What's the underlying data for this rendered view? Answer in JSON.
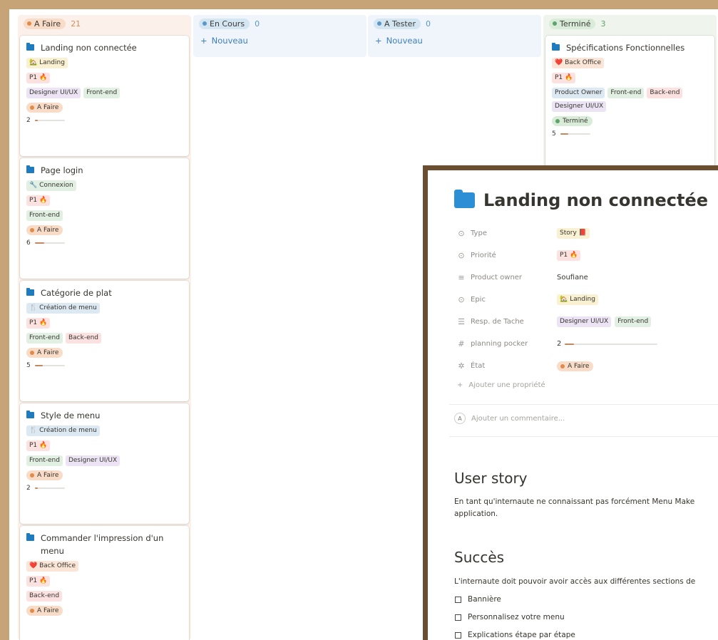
{
  "board": {
    "columns": [
      {
        "status": "A Faire",
        "count": "21",
        "color": "#e08b4a",
        "pill_bg": "#f8dcc8"
      },
      {
        "status": "En Cours",
        "count": "0",
        "color": "#5b97c9",
        "pill_bg": "#d5e6f3",
        "new_label": "Nouveau"
      },
      {
        "status": "A Tester",
        "count": "0",
        "color": "#5b97c9",
        "pill_bg": "#d5e6f3",
        "new_label": "Nouveau"
      },
      {
        "status": "Terminé",
        "count": "3",
        "color": "#5ea36a",
        "pill_bg": "#d8ecd9"
      }
    ],
    "cards": [
      {
        "title": "Landing non connectée",
        "epic": "🏡 Landing",
        "priority": "P1 🔥",
        "roles": [
          "Designer UI/UX",
          "Front-end"
        ],
        "state": "A Faire",
        "points": "2",
        "progress": 0.1
      },
      {
        "title": "Page login",
        "epic": "🔧 Connexion",
        "priority": "P1 🔥",
        "roles": [
          "Front-end"
        ],
        "state": "A Faire",
        "points": "6",
        "progress": 0.3
      },
      {
        "title": "Catégorie de plat",
        "epic": "🍴 Création de menu",
        "priority": "P1 🔥",
        "roles": [
          "Front-end",
          "Back-end"
        ],
        "state": "A Faire",
        "points": "5",
        "progress": 0.25
      },
      {
        "title": "Style de menu",
        "epic": "🍴 Création de menu",
        "priority": "P1 🔥",
        "roles": [
          "Front-end",
          "Designer UI/UX"
        ],
        "state": "A Faire",
        "points": "2",
        "progress": 0.1
      },
      {
        "title": "Commander l'impression d'un menu",
        "epic": "❤️ Back Office",
        "priority": "P1 🔥",
        "roles": [
          "Back-end"
        ],
        "state": "A Faire"
      }
    ],
    "done_card": {
      "title": "Spécifications Fonctionnelles",
      "epic": "❤️ Back Office",
      "priority": "P1 🔥",
      "roles": [
        "Product Owner",
        "Front-end",
        "Back-end",
        "Designer UI/UX"
      ],
      "state": "Terminé",
      "points": "5",
      "progress": 0.25
    }
  },
  "popup": {
    "title": "Landing non connectée",
    "properties": [
      {
        "name": "Type",
        "icon": "⊙",
        "value": "Story 📕"
      },
      {
        "name": "Priorité",
        "icon": "⊙",
        "value": "P1 🔥"
      },
      {
        "name": "Product owner",
        "icon": "≡",
        "value": "Soufiane"
      },
      {
        "name": "Epic",
        "icon": "⊙",
        "value": "🏡 Landing"
      },
      {
        "name": "Resp. de Tache",
        "icon": "☰",
        "values": [
          "Designer UI/UX",
          "Front-end"
        ]
      },
      {
        "name": "planning pocker",
        "icon": "#",
        "value": "2",
        "progress": 0.1
      },
      {
        "name": "État",
        "icon": "✲",
        "value": "A Faire"
      }
    ],
    "add_property": "Ajouter une propriété",
    "comment_avatar": "A",
    "comment_placeholder": "Ajouter un commentaire...",
    "sections": [
      {
        "heading": "User story",
        "text1": "En tant qu'internaute ne connaissant pas forcément Menu Make",
        "text2": "application."
      },
      {
        "heading": "Succès",
        "text1": "L'internaute doit pouvoir avoir accès aux différentes sections de"
      }
    ],
    "checklist": [
      "Bannière",
      "Personnalisez votre menu",
      "Explications étape par étape"
    ]
  }
}
